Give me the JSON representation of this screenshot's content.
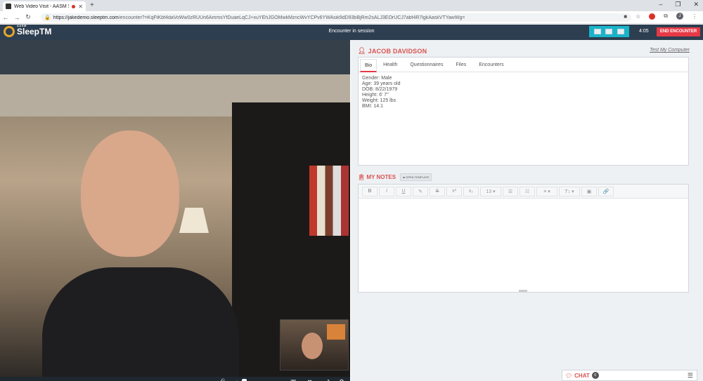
{
  "browser": {
    "tab_title": "Web Video Visit - AASM Sle",
    "new_tab": "+",
    "url_domain": "https://jakedemo.sleeptm.com",
    "url_path": "/encounter?=KqFtKbf4daVoWw0zRUUn6AmmsYfDuaeLqCJ+xuYEhJGOMwkMzncWvYCPv6YWAsik9dD93bBjRm2sALJ3EOrUCJ7abf4R7lgkAaskVTYawWg=",
    "window_controls": {
      "minimize": "–",
      "restore": "❐",
      "close": "✕"
    },
    "nav": {
      "back": "←",
      "forward": "→",
      "reload": "↻"
    },
    "avatar_letter": "J"
  },
  "header": {
    "logo_small": "AASM",
    "logo_text": "SleepTM",
    "session_title": "Encounter in session",
    "timer": "4:05",
    "end_button": "END ENCOUNTER"
  },
  "patient": {
    "name": "JACOB DAVIDSON",
    "test_link": "Test My Computer"
  },
  "tabs": [
    "Bio",
    "Health",
    "Questionnaires",
    "Files",
    "Encounters"
  ],
  "bio": {
    "gender": "Gender: Male",
    "age": "Age: 39 years old",
    "dob": "DOB: 8/22/1979",
    "height": "Height: 6' 7\"",
    "weight": "Weight: 125 lbs",
    "bmi": "BMI: 14.1"
  },
  "notes": {
    "heading": "MY NOTES",
    "open_template": "OPEN TEMPLATE",
    "toolbar": {
      "bold": "B",
      "italic": "I",
      "underline": "U",
      "eraser": "✎",
      "strike": "S",
      "superscript": "x²",
      "subscript": "x₂",
      "font_size": "13 ▾",
      "ul": "☰",
      "ol": "☷",
      "align": "≡ ▾",
      "text_style": "T↕ ▾",
      "image": "▣",
      "link": "🔗"
    }
  },
  "chat": {
    "label": "CHAT",
    "count": "0"
  }
}
